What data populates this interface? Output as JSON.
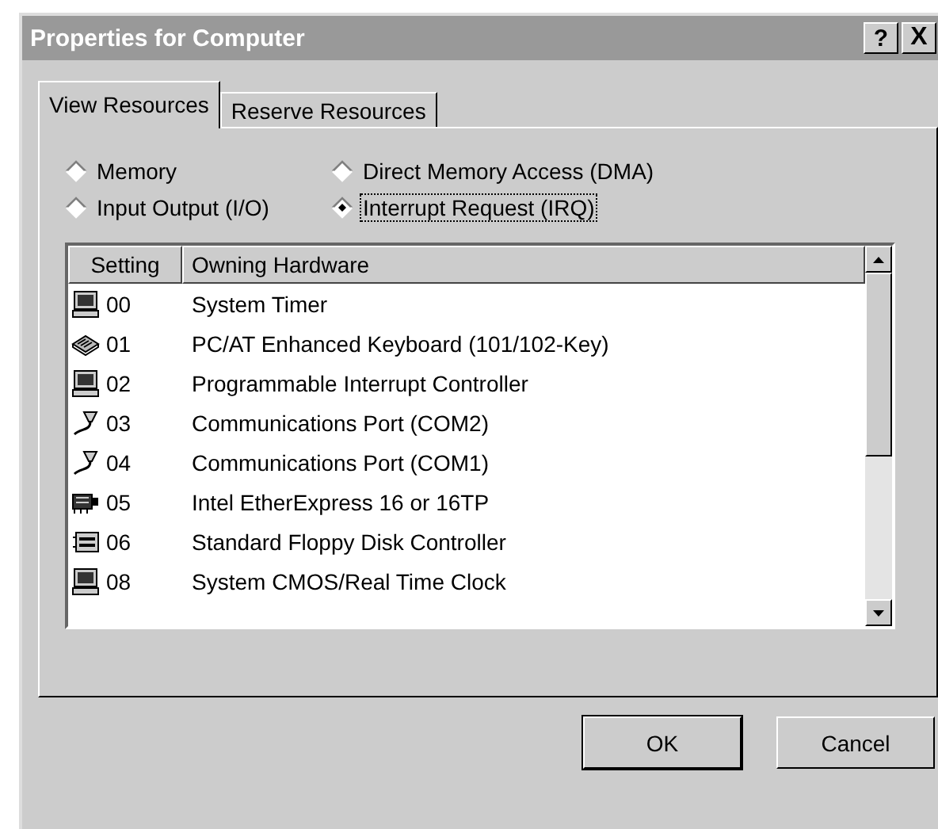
{
  "window": {
    "title": "Properties for Computer",
    "buttons": [
      {
        "kind": "help",
        "label": "?"
      },
      {
        "kind": "close",
        "label": "X"
      }
    ]
  },
  "tabs": [
    {
      "label": "View Resources",
      "selected": true
    },
    {
      "label": "Reserve Resources",
      "selected": false
    }
  ],
  "resource_types": [
    {
      "label": "Memory",
      "selected": false
    },
    {
      "label": "Direct Memory Access (DMA)",
      "selected": false
    },
    {
      "label": "Input Output (I/O)",
      "selected": false
    },
    {
      "label": "Interrupt Request (IRQ)",
      "selected": true
    }
  ],
  "table": {
    "columns": [
      "Setting",
      "Owning Hardware"
    ],
    "rows": [
      {
        "kind": "computer",
        "setting": "00",
        "hardware": "System Timer"
      },
      {
        "kind": "keyboard",
        "setting": "01",
        "hardware": "PC/AT Enhanced Keyboard (101/102-Key)"
      },
      {
        "kind": "computer",
        "setting": "02",
        "hardware": "Programmable Interrupt Controller"
      },
      {
        "kind": "port",
        "setting": "03",
        "hardware": "Communications Port (COM2)"
      },
      {
        "kind": "port",
        "setting": "04",
        "hardware": "Communications Port (COM1)"
      },
      {
        "kind": "network",
        "setting": "05",
        "hardware": "Intel EtherExpress 16 or 16TP"
      },
      {
        "kind": "floppy",
        "setting": "06",
        "hardware": "Standard Floppy Disk Controller"
      },
      {
        "kind": "computer",
        "setting": "08",
        "hardware": "System CMOS/Real Time Clock"
      }
    ]
  },
  "buttons": [
    "OK",
    "Cancel"
  ]
}
